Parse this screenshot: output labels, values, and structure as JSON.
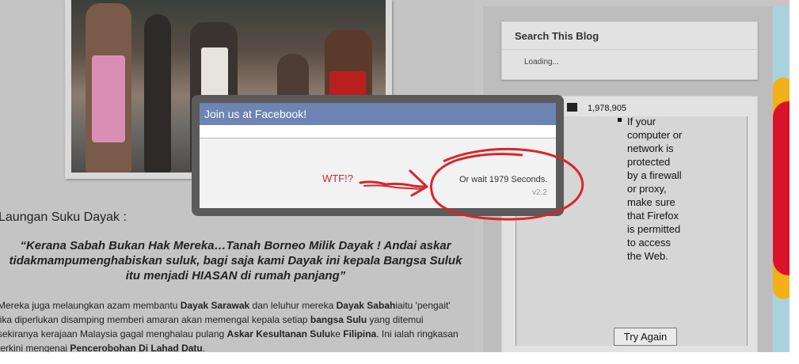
{
  "main": {
    "section_title": "Laungan Suku Dayak :",
    "quote_open": "“",
    "quote_text": "Kerana Sabah Bukan Hak Mereka…Tanah Borneo Milik Dayak ! Andai askar tidakmampumenghabiskan suluk, bagi saja kami Dayak ini kepala Bangsa Suluk itu menjadi HIASAN di rumah panjang",
    "quote_close": "”",
    "paragraph": [
      {
        "text": "Mereka juga melaungkan azam membantu ",
        "bold": false
      },
      {
        "text": "Dayak Sarawak",
        "bold": true
      },
      {
        "text": " dan leluhur mereka ",
        "bold": false
      },
      {
        "text": "Dayak Sabah",
        "bold": true
      },
      {
        "text": "iaitu 'pengait' jika diperlukan disamping memberi amaran akan memengal kepala setiap ",
        "bold": false
      },
      {
        "text": "bangsa Sulu",
        "bold": true
      },
      {
        "text": " yang ditemui sekiranya kerajaan Malaysia gagal menghalau pulang ",
        "bold": false
      },
      {
        "text": "Askar Kesultanan Sulu",
        "bold": true
      },
      {
        "text": "ke ",
        "bold": false
      },
      {
        "text": "Filipina",
        "bold": true
      },
      {
        "text": ". Ini ialah ringkasan terkini mengenai ",
        "bold": false
      },
      {
        "text": "Pencerobohan Di Lahad Datu",
        "bold": true
      },
      {
        "text": ".",
        "bold": false
      }
    ]
  },
  "sidebar": {
    "search_title": "Search This Blog",
    "search_loading": "Loading...",
    "counter_value": "1,978,905",
    "error_message": "If your computer or network is protected by a firewall or proxy, make sure that Firefox is permitted to access the Web.",
    "try_again_label": "Try Again"
  },
  "facebook_popup": {
    "title": "Join us at Facebook!",
    "wait_text": "Or wait 1979 Seconds.",
    "version": "v2.2"
  },
  "annotation": {
    "label": "WTF!?",
    "color": "#d8262a"
  },
  "colors": {
    "fb_header": "#6d84b4",
    "page_bg": "#c6c6c6",
    "annotation_red": "#d8262a"
  }
}
